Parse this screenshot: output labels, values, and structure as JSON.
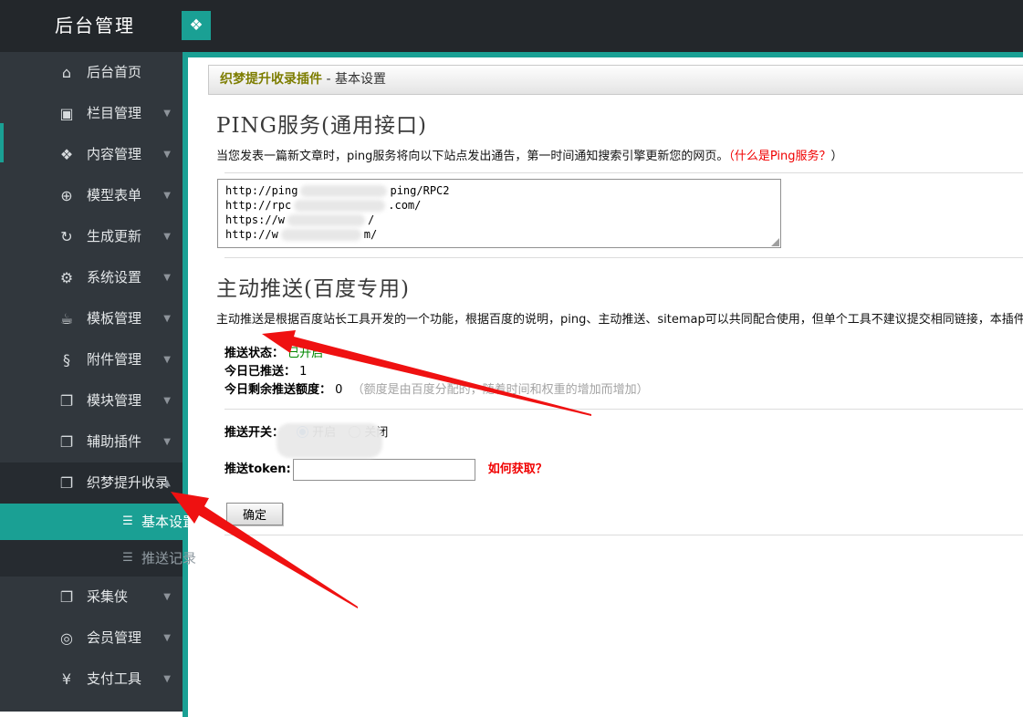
{
  "header": {
    "title": "后台管理",
    "app_icon_glyph": "❖"
  },
  "sidebar": {
    "items": [
      {
        "label": "后台首页",
        "glyph": "⌂",
        "caret": ""
      },
      {
        "label": "栏目管理",
        "glyph": "▣",
        "caret": "▼"
      },
      {
        "label": "内容管理",
        "glyph": "❖",
        "caret": "▼"
      },
      {
        "label": "模型表单",
        "glyph": "⊕",
        "caret": "▼"
      },
      {
        "label": "生成更新",
        "glyph": "↻",
        "caret": "▼"
      },
      {
        "label": "系统设置",
        "glyph": "⚙",
        "caret": "▼"
      },
      {
        "label": "模板管理",
        "glyph": "☕",
        "caret": "▼"
      },
      {
        "label": "附件管理",
        "glyph": "§",
        "caret": "▼"
      },
      {
        "label": "模块管理",
        "glyph": "❐",
        "caret": "▼"
      },
      {
        "label": "辅助插件",
        "glyph": "❐",
        "caret": "▼"
      },
      {
        "label": "织梦提升收录",
        "glyph": "❐",
        "caret": "▲"
      },
      {
        "label": "基本设置",
        "glyph": "☰"
      },
      {
        "label": "推送记录",
        "glyph": "☰"
      },
      {
        "label": "采集侠",
        "glyph": "❐",
        "caret": "▼"
      },
      {
        "label": "会员管理",
        "glyph": "◎",
        "caret": "▼"
      },
      {
        "label": "支付工具",
        "glyph": "¥",
        "caret": "▼"
      }
    ]
  },
  "titlebar": {
    "plugin": "织梦提升收录插件",
    "sep": "-",
    "page": "基本设置"
  },
  "ping_section": {
    "heading": "PING服务(通用接口)",
    "description": "当您发表一篇新文章时，ping服务将向以下站点发出通告，第一时间通知搜索引擎更新您的网页。",
    "link_red": "（什么是Ping服务？",
    "link_close": "）",
    "lines": [
      {
        "prefix": "http://ping",
        "suffix": "ping/RPC2"
      },
      {
        "prefix": "http://rpc",
        "suffix": ".com/"
      },
      {
        "prefix": "https://w",
        "suffix": "/"
      },
      {
        "prefix": "http://w",
        "suffix": "m/"
      }
    ]
  },
  "push_section": {
    "heading": "主动推送(百度专用)",
    "description": "主动推送是根据百度站长工具开发的一个功能，根据百度的说明，ping、主动推送、sitemap可以共同配合使用，但单个工具不建议提交相同链接，本插件完全根据百度",
    "status_label": "推送状态：",
    "status_value": "已开启",
    "today_label": "今日已推送：",
    "today_value": "1",
    "quota_label": "今日剩余推送额度：",
    "quota_value": "0",
    "quota_note": "（额度是由百度分配的，随着时间和权重的增加而增加）",
    "switch_label": "推送开关：",
    "radio_on_label": "开启",
    "radio_off_label": "关闭",
    "token_label": "推送token:",
    "token_value": "",
    "help_link": "如何获取？",
    "submit_label": "确定"
  },
  "colors": {
    "accent": "#1aa094",
    "status_green": "#008800",
    "annotation_red": "#ef1111",
    "radio_blue": "#2470d8",
    "plugin_title_olive": "#7d7d00"
  }
}
